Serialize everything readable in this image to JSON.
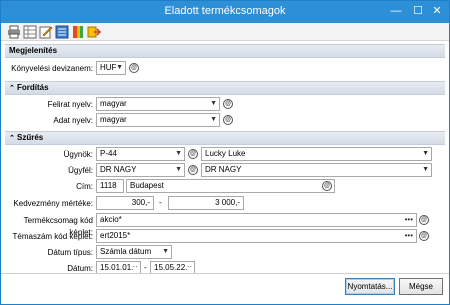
{
  "window": {
    "title": "Eladott termékcsomagok",
    "min_glyph": "—",
    "max_glyph": "☐",
    "close_glyph": "✕"
  },
  "toolbar": {
    "icons": [
      "printer-icon",
      "grid-icon",
      "edit-icon",
      "list-icon",
      "book-icon",
      "export-icon"
    ]
  },
  "sections": {
    "megjelenites": {
      "title": "Megjelenítés",
      "konyvelesi_label": "Könyvelési devizanem:",
      "konyvelesi_value": "HUF"
    },
    "forditas": {
      "title": "Fordítás",
      "felirat_label": "Felirat nyelv:",
      "felirat_value": "magyar",
      "adat_label": "Adat nyelv:",
      "adat_value": "magyar"
    },
    "szures": {
      "title": "Szűrés",
      "ugynok_label": "Ügynök:",
      "ugynok_code": "P-44",
      "ugynok_name": "Lucky Luke",
      "ugyfel_label": "Ügyfél:",
      "ugyfel_code": "DR NAGY",
      "ugyfel_name": "DR NAGY",
      "cim_label": "Cím:",
      "cim_zip": "1118",
      "cim_city": "Budapest",
      "kedvezmeny_label": "Kedvezmény mértéke:",
      "kedvezmeny_from": "300,-",
      "kedvezmeny_dash": "-",
      "kedvezmeny_to": "3 000,-",
      "termekcsomag_label": "Termékcsomag kód képlet:",
      "termekcsomag_value": "akcio*",
      "temaszam_label": "Témaszám kód képlet:",
      "temaszam_value": "ert2015*",
      "datum_tipus_label": "Dátum típus:",
      "datum_tipus_value": "Számla dátum",
      "datum_label": "Dátum:",
      "datum_from": "15.01.01.",
      "datum_dash": "-",
      "datum_to": "15.05.22."
    }
  },
  "footer": {
    "print_label": "Nyomtatás...",
    "cancel_label": "Mégse"
  },
  "colors": {
    "titlebar": "#2d8fd6",
    "section_bg": "#dfe5ed",
    "accent": "#3c7fb1"
  }
}
